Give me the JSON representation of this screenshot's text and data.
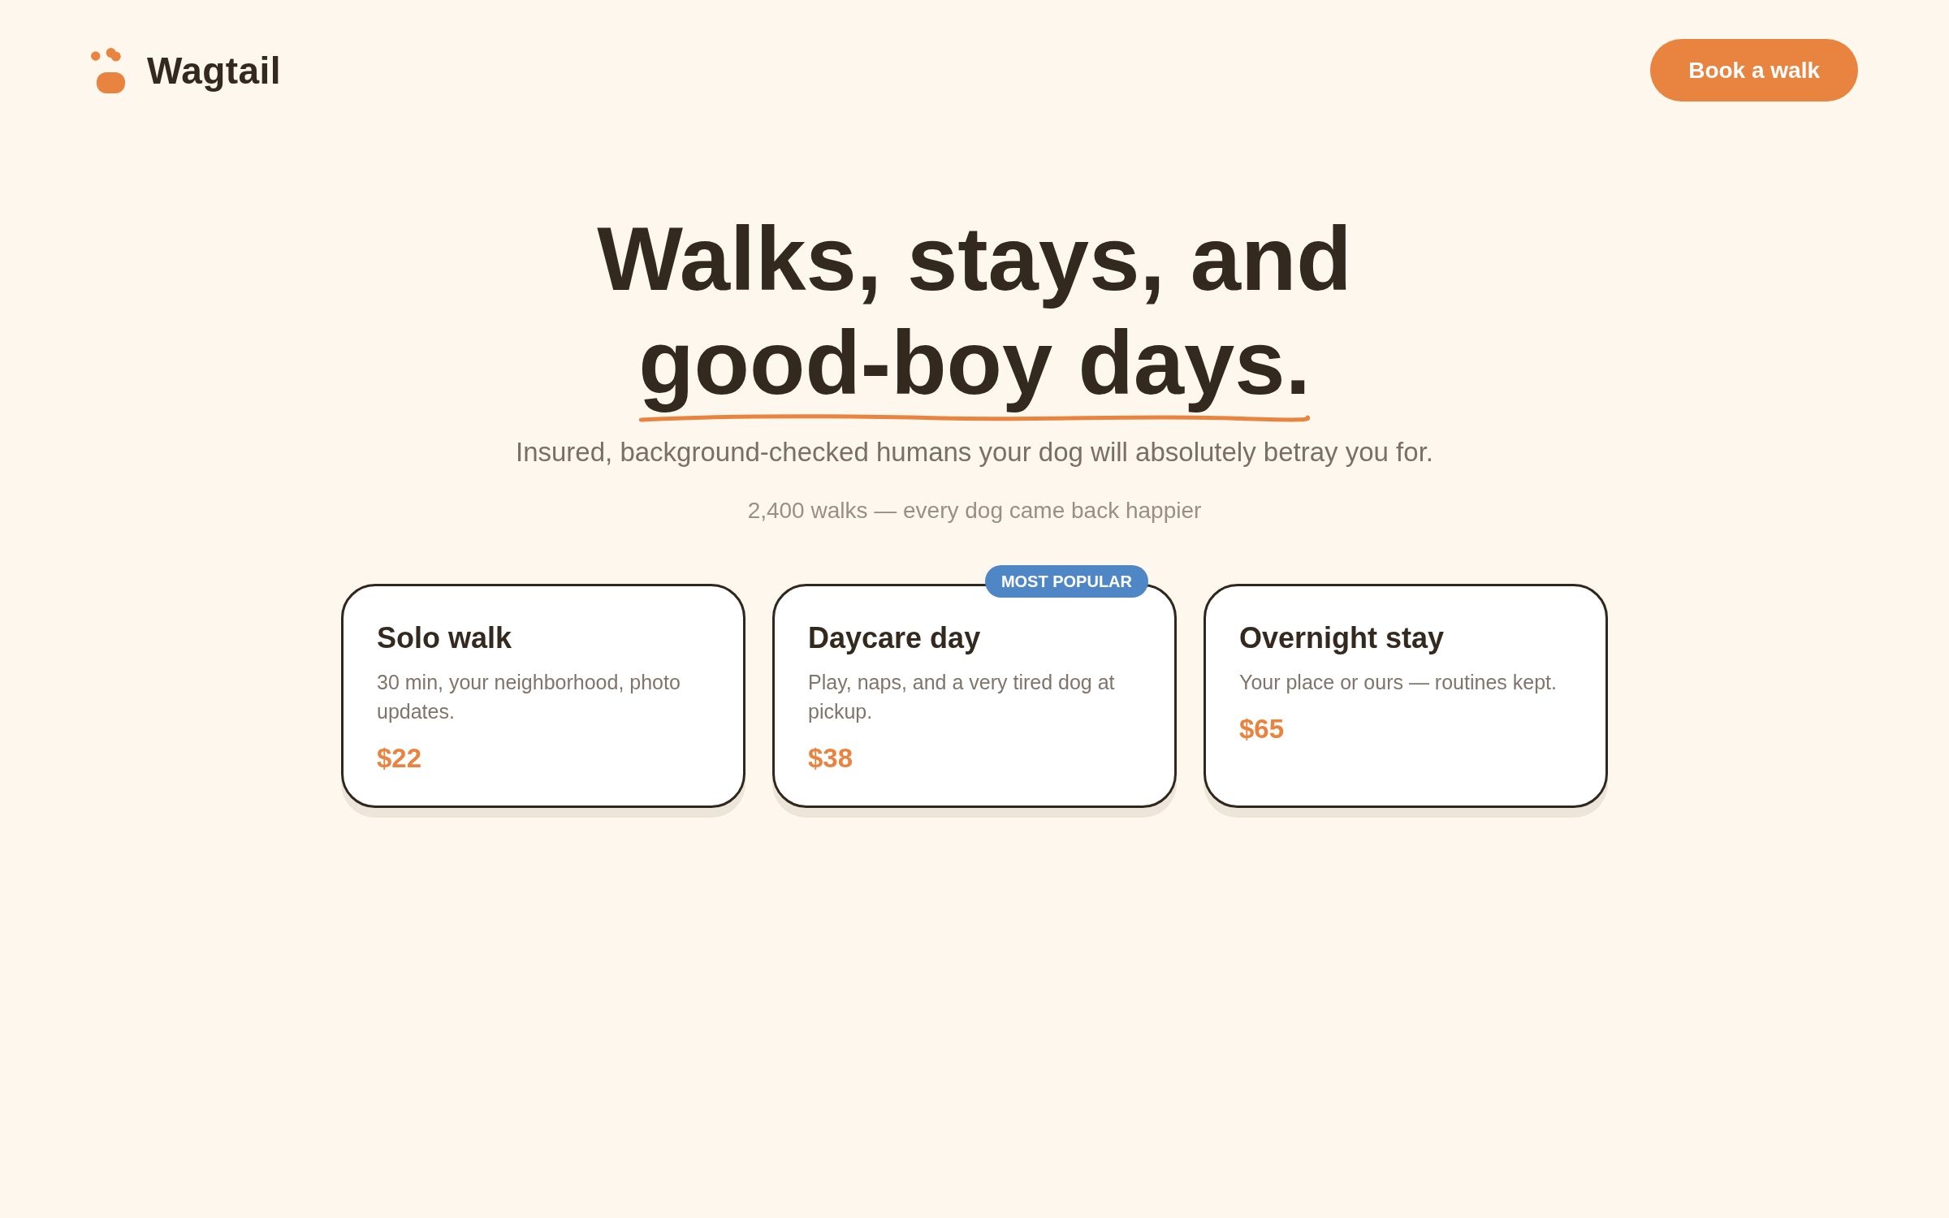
{
  "header": {
    "brand": "Wagtail",
    "cta": "Book a walk"
  },
  "hero": {
    "headline": {
      "lines": [
        {
          "text": "Walks, stays, and",
          "underlined": false
        },
        {
          "text": "good-boy days.",
          "underlined": true
        }
      ]
    },
    "subtitle": "Insured, background-checked humans your dog will absolutely betray you for.",
    "stat": "2,400 walks — every dog came back happier"
  },
  "services": [
    {
      "title": "Solo walk",
      "description": "30 min, your neighborhood, photo updates.",
      "price": "$22"
    },
    {
      "title": "Daycare day",
      "description": "Play, naps, and a very tired dog at pickup.",
      "price": "$38",
      "badge": "MOST POPULAR"
    },
    {
      "title": "Overnight stay",
      "description": "Your place or ours — routines kept.",
      "price": "$65"
    }
  ]
}
